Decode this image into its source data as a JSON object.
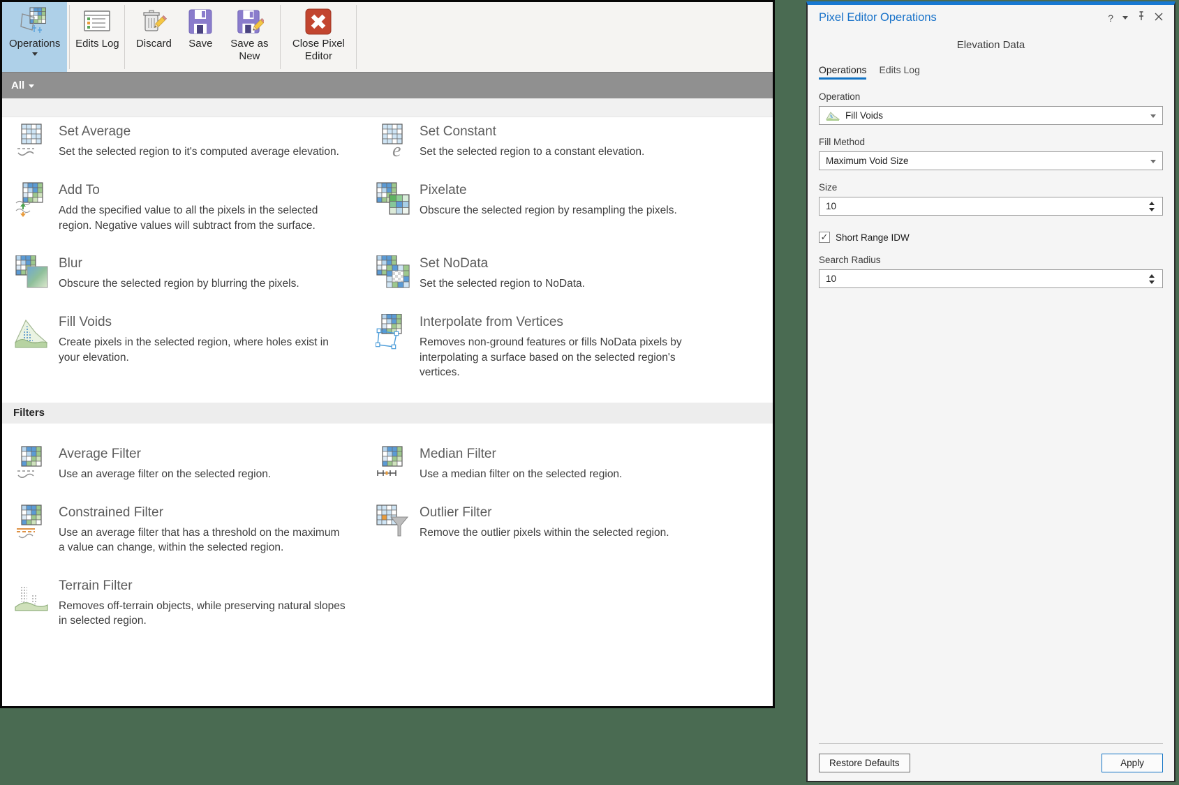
{
  "ribbon": {
    "operations_label": "Operations",
    "edits_log_label": "Edits Log",
    "discard_label": "Discard",
    "save_label": "Save",
    "save_as_new_label": "Save as New",
    "close_label": "Close Pixel Editor",
    "filter_label": "All"
  },
  "gallery": {
    "operations": [
      {
        "name": "Set Average",
        "desc": "Set the selected region to it's computed average elevation."
      },
      {
        "name": "Set Constant",
        "desc": "Set the selected region to a constant elevation."
      },
      {
        "name": "Add To",
        "desc": "Add the specified value to all the pixels in the selected region. Negative values will subtract from the surface."
      },
      {
        "name": "Pixelate",
        "desc": "Obscure the selected region by resampling the pixels."
      },
      {
        "name": "Blur",
        "desc": "Obscure the selected region by blurring the pixels."
      },
      {
        "name": "Set NoData",
        "desc": "Set the selected region to NoData."
      },
      {
        "name": "Fill Voids",
        "desc": "Create pixels in the selected region, where holes exist in your elevation."
      },
      {
        "name": "Interpolate from Vertices",
        "desc": "Removes non-ground features or fills NoData pixels by interpolating a surface based on the selected region's vertices."
      }
    ],
    "filters_header": "Filters",
    "filters": [
      {
        "name": "Average Filter",
        "desc": "Use an average filter on the selected region."
      },
      {
        "name": "Median Filter",
        "desc": "Use a median filter on the selected region."
      },
      {
        "name": "Constrained Filter",
        "desc": "Use an average filter that has a threshold on the maximum a value can change, within the selected region."
      },
      {
        "name": "Outlier Filter",
        "desc": "Remove the outlier pixels within the selected region."
      },
      {
        "name": "Terrain Filter",
        "desc": "Removes off-terrain objects, while preserving natural slopes in selected region."
      }
    ]
  },
  "pane": {
    "title": "Pixel Editor Operations",
    "help_glyph": "?",
    "subtitle": "Elevation Data",
    "tab_operations": "Operations",
    "tab_edits_log": "Edits Log",
    "operation_label": "Operation",
    "operation_value": "Fill Voids",
    "fill_method_label": "Fill Method",
    "fill_method_value": "Maximum Void Size",
    "size_label": "Size",
    "size_value": "10",
    "short_range_label": "Short Range IDW",
    "short_range_checked": true,
    "check_glyph": "✓",
    "search_radius_label": "Search Radius",
    "search_radius_value": "10",
    "restore_label": "Restore Defaults",
    "apply_label": "Apply"
  },
  "colors": {
    "accent_blue": "#1273c4",
    "pane_title_blue": "#1872c9",
    "ribbon_highlight_blue": "#aed0e8",
    "desktop_green": "#4a6b52",
    "close_button_red": "#c2452f",
    "save_icon_purple": "#8a7ccc",
    "orange_accent": "#e89b3c"
  }
}
